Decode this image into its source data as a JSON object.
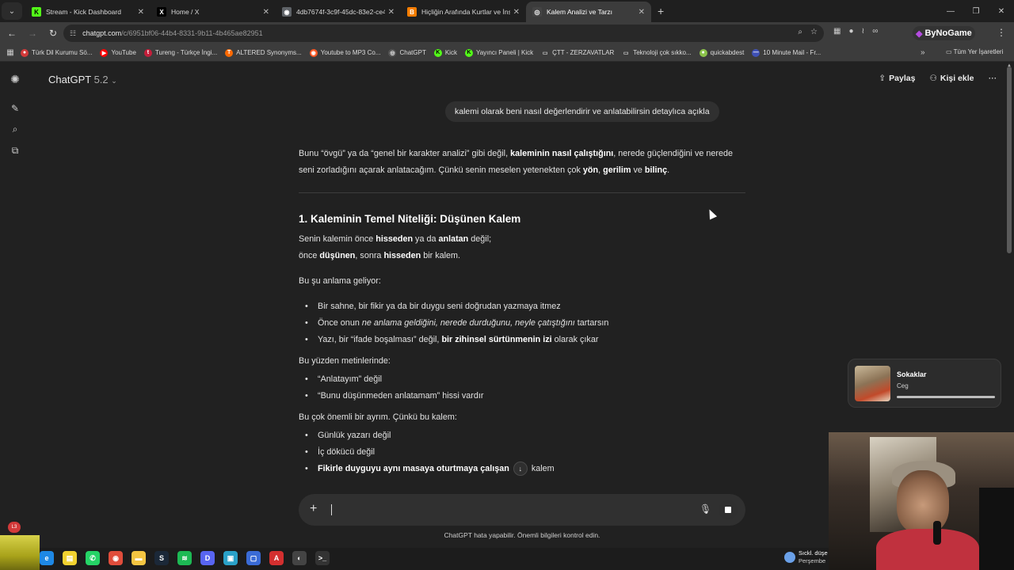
{
  "browser": {
    "tabs": [
      {
        "title": "Stream - Kick Dashboard",
        "favicon": "kick-icon",
        "fav_color": "#53fc18",
        "fav_letter": "K",
        "active": false
      },
      {
        "title": "Home / X",
        "favicon": "x-icon",
        "fav_color": "#000000",
        "fav_letter": "X",
        "active": false
      },
      {
        "title": "4db7674f-3c9f-45dc-83e2-ce4...",
        "favicon": "globe-icon",
        "fav_color": "#5f6368",
        "fav_letter": "◉",
        "active": false
      },
      {
        "title": "Hiçliğin Arafında Kurtlar ve İnsa...",
        "favicon": "blogger-icon",
        "fav_color": "#f57d00",
        "fav_letter": "B",
        "active": false
      },
      {
        "title": "Kalem Analizi ve Tarzı",
        "favicon": "chatgpt-icon",
        "fav_color": "#444444",
        "fav_letter": "◎",
        "active": true
      }
    ],
    "url_host": "chatgpt.com",
    "url_path": "/c/6951bf06-44b4-8331-9b11-4b465ae82951",
    "extension_label": "ByNoGame",
    "bookmarks": [
      {
        "label": "Türk Dil Kurumu Sö...",
        "color": "#d23a3a",
        "letter": "●"
      },
      {
        "label": "YouTube",
        "color": "#ff0000",
        "letter": "▶"
      },
      {
        "label": "Tureng - Türkçe İngi...",
        "color": "#c41e3a",
        "letter": "t"
      },
      {
        "label": "ALTERED Synonyms...",
        "color": "#ff6a00",
        "letter": "T"
      },
      {
        "label": "Youtube to MP3 Co...",
        "color": "#ff5722",
        "letter": "◉"
      },
      {
        "label": "ChatGPT",
        "color": "#555555",
        "letter": "◎"
      },
      {
        "label": "Kick",
        "color": "#53fc18",
        "letter": "K"
      },
      {
        "label": "Yayıncı Paneli | Kick",
        "color": "#53fc18",
        "letter": "K"
      },
      {
        "label": "ÇTT - ZERZAVATLAR",
        "color": "#888888",
        "letter": "▭"
      },
      {
        "label": "Teknoloji çok sıkko...",
        "color": "#888888",
        "letter": "▭"
      },
      {
        "label": "quickabdest",
        "color": "#8bc34a",
        "letter": "●"
      },
      {
        "label": "10 Minute Mail - Fr...",
        "color": "#3f51b5",
        "letter": "—"
      }
    ],
    "all_bookmarks_label": "Tüm Yer İşaretleri"
  },
  "app": {
    "model_name": "ChatGPT",
    "model_version": "5.2",
    "share_label": "Paylaş",
    "add_person_label": "Kişi ekle"
  },
  "conversation": {
    "user_message": "kalemi olarak beni nasıl değerlendirir ve anlatabilirsin detaylıca açıkla",
    "intro": {
      "t1": "Bunu “övgü” ya da “genel bir karakter analizi” gibi değil, ",
      "b1": "kaleminin nasıl çalıştığını",
      "t2": ", nerede güçlendiğini ve nerede seni zorladığını açarak anlatacağım. Çünkü senin meselen yetenekten çok ",
      "b2": "yön",
      "t3": ", ",
      "b3": "gerilim",
      "t4": " ve ",
      "b4": "bilinç",
      "t5": "."
    },
    "heading": "1. Kaleminin Temel Niteliği: Düşünen Kalem",
    "para1": {
      "t1": "Senin kalemin önce ",
      "b1": "hisseden",
      "t2": " ya da ",
      "b2": "anlatan",
      "t3": " değil;",
      "t4": "önce ",
      "b3": "düşünen",
      "t5": ", sonra ",
      "b4": "hisseden",
      "t6": " bir kalem."
    },
    "lead1": "Bu şu anlama geliyor:",
    "list1": {
      "i1": "Bir sahne, bir fikir ya da bir duygu seni doğrudan yazmaya itmez",
      "i2_a": "Önce onun ",
      "i2_em": "ne anlama geldiğini, nerede durduğunu, neyle çatıştığını",
      "i2_b": " tartarsın",
      "i3_a": "Yazı, bir “ifade boşalması” değil, ",
      "i3_b": "bir zihinsel sürtünmenin izi",
      "i3_c": " olarak çıkar"
    },
    "lead2": "Bu yüzden metinlerinde:",
    "list2": [
      "“Anlatayım” değil",
      "“Bunu düşünmeden anlatamam” hissi vardır"
    ],
    "lead3": "Bu çok önemli bir ayrım. Çünkü bu kalem:",
    "list3": {
      "i1": "Günlük yazarı değil",
      "i2": "İç dökücü değil",
      "i3_b": "Fikirle duyguyu aynı masaya oturtmaya çalışan",
      "i3_c": "kalem"
    }
  },
  "composer": {
    "disclaimer": "ChatGPT hata yapabilir. Önemli bilgileri kontrol edin."
  },
  "now_playing": {
    "song": "Sokaklar",
    "artist": "Ceg",
    "progress": 1.0
  },
  "taskbar": {
    "notification_count": "L3",
    "weather_line1": "Sıckl. düşe",
    "weather_line2": "Perşembe",
    "icons": [
      {
        "name": "edge-icon",
        "color": "#1e88e5",
        "letter": "e"
      },
      {
        "name": "sticky-notes-icon",
        "color": "#f2d230",
        "letter": "▤"
      },
      {
        "name": "whatsapp-icon",
        "color": "#25d366",
        "letter": "✆"
      },
      {
        "name": "chrome-icon",
        "color": "#e04d3b",
        "letter": "◉"
      },
      {
        "name": "file-explorer-icon",
        "color": "#f4c542",
        "letter": "▬"
      },
      {
        "name": "steam-icon",
        "color": "#1b2838",
        "letter": "S"
      },
      {
        "name": "spotify-icon",
        "color": "#1db954",
        "letter": "≋"
      },
      {
        "name": "discord-icon",
        "color": "#5865f2",
        "letter": "D"
      },
      {
        "name": "app-icon",
        "color": "#2aa1c8",
        "letter": "▣"
      },
      {
        "name": "app2-icon",
        "color": "#3a6bd6",
        "letter": "▢"
      },
      {
        "name": "pdf-icon",
        "color": "#d32f2f",
        "letter": "A"
      },
      {
        "name": "obs-icon",
        "color": "#444444",
        "letter": "◐"
      },
      {
        "name": "terminal-icon",
        "color": "#333333",
        "letter": ">_"
      }
    ]
  }
}
